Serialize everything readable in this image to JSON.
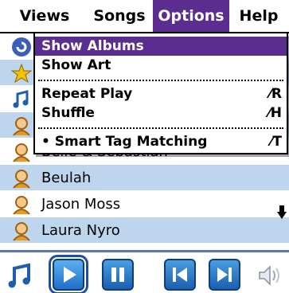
{
  "menubar": {
    "items": [
      {
        "label": "Views"
      },
      {
        "label": "Songs"
      },
      {
        "label": "Options"
      },
      {
        "label": "Help"
      }
    ]
  },
  "dropdown": {
    "items": [
      {
        "label": "Show Albums",
        "shortcut": ""
      },
      {
        "label": "Show Art",
        "shortcut": ""
      },
      {
        "label": "Repeat Play",
        "shortcut": "⁄R"
      },
      {
        "label": "Shuffle",
        "shortcut": "⁄H"
      },
      {
        "label": "• Smart Tag Matching",
        "shortcut": "⁄T"
      }
    ]
  },
  "list": {
    "rows": [
      {
        "label": ""
      },
      {
        "label": ""
      },
      {
        "label": ""
      },
      {
        "label": ""
      },
      {
        "label": "Belle & Sebastian"
      },
      {
        "label": "Beulah"
      },
      {
        "label": "Jason Moss"
      },
      {
        "label": "Laura Nyro"
      }
    ]
  },
  "colors": {
    "accent": "#5b2d8e",
    "row_highlight": "#bdd6ee",
    "button_blue": "#2a7fd0"
  }
}
